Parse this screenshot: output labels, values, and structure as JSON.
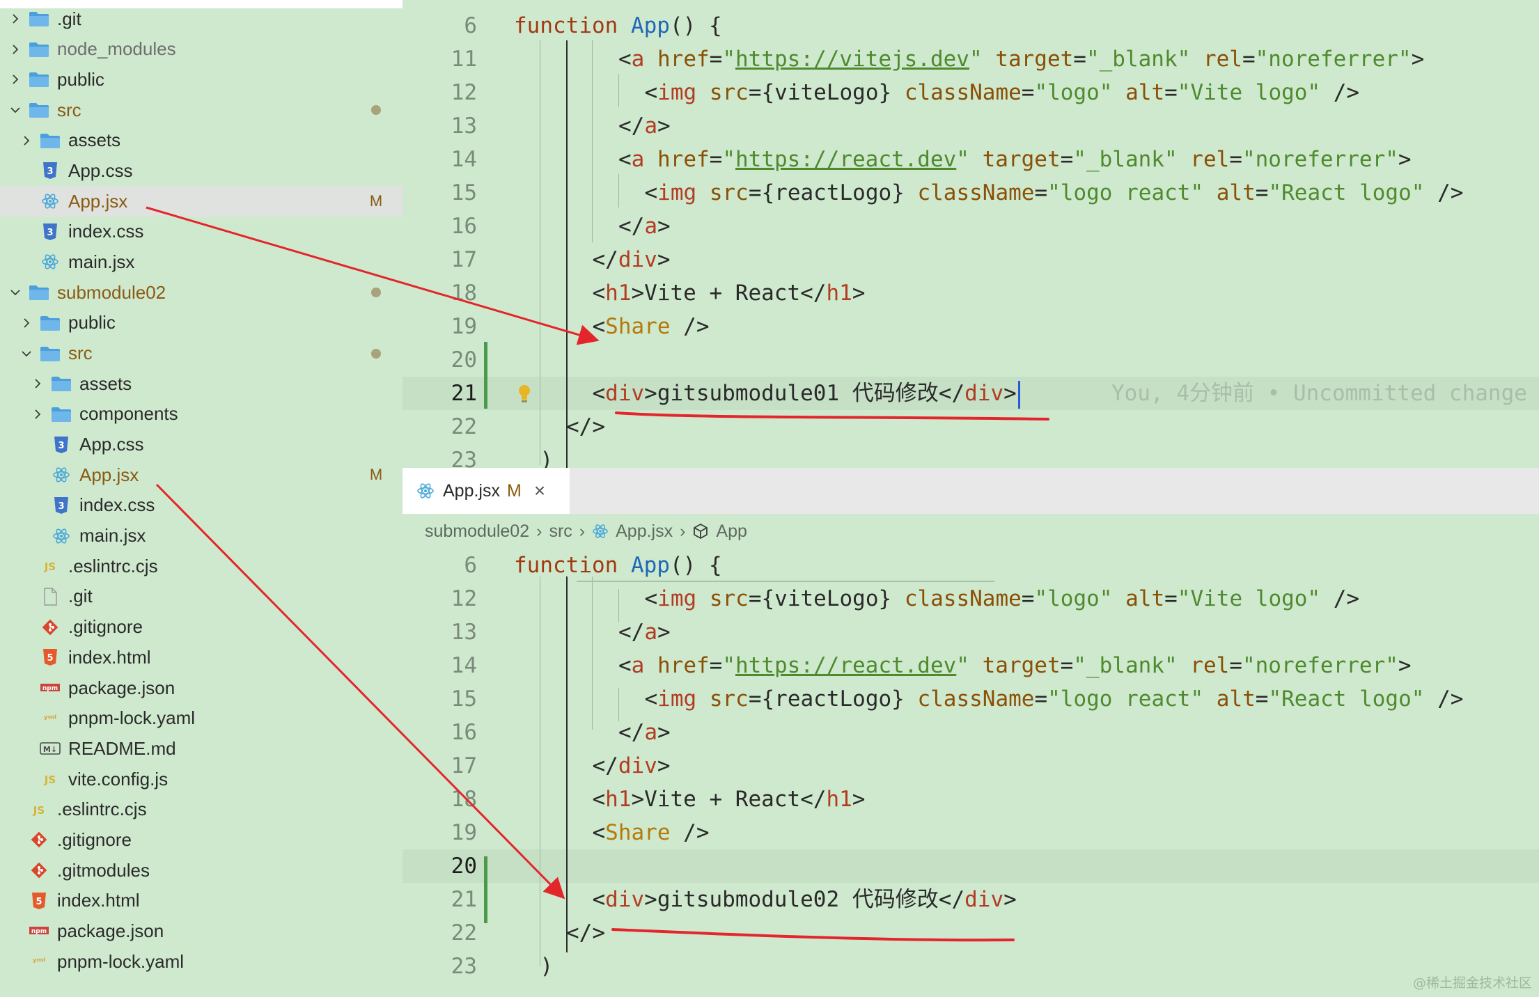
{
  "explorer": {
    "items": [
      {
        "label": ".git",
        "kind": "folder",
        "expanded": false,
        "depth": 0,
        "icon": "folder-icon"
      },
      {
        "label": "node_modules",
        "kind": "folder",
        "expanded": false,
        "depth": 0,
        "icon": "folder-icon",
        "dim": true
      },
      {
        "label": "public",
        "kind": "folder",
        "expanded": false,
        "depth": 0,
        "icon": "folder-icon"
      },
      {
        "label": "src",
        "kind": "folder",
        "expanded": true,
        "depth": 0,
        "icon": "folder-icon",
        "modified": true,
        "status": "dot"
      },
      {
        "label": "assets",
        "kind": "folder",
        "expanded": false,
        "depth": 1,
        "icon": "folder-icon"
      },
      {
        "label": "App.css",
        "kind": "file",
        "depth": 1,
        "icon": "css-file-icon"
      },
      {
        "label": "App.jsx",
        "kind": "file",
        "depth": 1,
        "icon": "react-file-icon",
        "modified": true,
        "status": "M",
        "selected": true
      },
      {
        "label": "index.css",
        "kind": "file",
        "depth": 1,
        "icon": "css-file-icon"
      },
      {
        "label": "main.jsx",
        "kind": "file",
        "depth": 1,
        "icon": "react-file-icon"
      },
      {
        "label": "submodule02",
        "kind": "folder",
        "expanded": true,
        "depth": 0,
        "icon": "folder-icon",
        "modified": true,
        "status": "dot"
      },
      {
        "label": "public",
        "kind": "folder",
        "expanded": false,
        "depth": 1,
        "icon": "folder-icon"
      },
      {
        "label": "src",
        "kind": "folder",
        "expanded": true,
        "depth": 1,
        "icon": "folder-icon",
        "modified": true,
        "status": "dot"
      },
      {
        "label": "assets",
        "kind": "folder",
        "expanded": false,
        "depth": 2,
        "icon": "folder-icon"
      },
      {
        "label": "components",
        "kind": "folder",
        "expanded": false,
        "depth": 2,
        "icon": "folder-icon"
      },
      {
        "label": "App.css",
        "kind": "file",
        "depth": 2,
        "icon": "css-file-icon"
      },
      {
        "label": "App.jsx",
        "kind": "file",
        "depth": 2,
        "icon": "react-file-icon",
        "modified": true,
        "status": "M"
      },
      {
        "label": "index.css",
        "kind": "file",
        "depth": 2,
        "icon": "css-file-icon"
      },
      {
        "label": "main.jsx",
        "kind": "file",
        "depth": 2,
        "icon": "react-file-icon"
      },
      {
        "label": ".eslintrc.cjs",
        "kind": "file",
        "depth": 1,
        "icon": "js-file-icon"
      },
      {
        "label": ".git",
        "kind": "file",
        "depth": 1,
        "icon": "blank-file-icon"
      },
      {
        "label": ".gitignore",
        "kind": "file",
        "depth": 1,
        "icon": "git-file-icon"
      },
      {
        "label": "index.html",
        "kind": "file",
        "depth": 1,
        "icon": "html-file-icon"
      },
      {
        "label": "package.json",
        "kind": "file",
        "depth": 1,
        "icon": "npm-file-icon"
      },
      {
        "label": "pnpm-lock.yaml",
        "kind": "file",
        "depth": 1,
        "icon": "yaml-file-icon"
      },
      {
        "label": "README.md",
        "kind": "file",
        "depth": 1,
        "icon": "markdown-file-icon"
      },
      {
        "label": "vite.config.js",
        "kind": "file",
        "depth": 1,
        "icon": "js-file-icon"
      },
      {
        "label": ".eslintrc.cjs",
        "kind": "file",
        "depth": 0,
        "icon": "js-file-icon"
      },
      {
        "label": ".gitignore",
        "kind": "file",
        "depth": 0,
        "icon": "git-file-icon"
      },
      {
        "label": ".gitmodules",
        "kind": "file",
        "depth": 0,
        "icon": "git-file-icon"
      },
      {
        "label": "index.html",
        "kind": "file",
        "depth": 0,
        "icon": "html-file-icon"
      },
      {
        "label": "package.json",
        "kind": "file",
        "depth": 0,
        "icon": "npm-file-icon"
      },
      {
        "label": "pnpm-lock.yaml",
        "kind": "file",
        "depth": 0,
        "icon": "yaml-file-icon"
      }
    ]
  },
  "editor_top": {
    "lines": [
      {
        "n": "6",
        "tokens": [
          [
            "kw",
            "function "
          ],
          [
            "fn",
            "App"
          ],
          [
            "txt",
            "() {"
          ]
        ]
      },
      {
        "n": "11",
        "tokens": [
          [
            "txt",
            "<"
          ],
          [
            "tag",
            "a"
          ],
          [
            "txt",
            " "
          ],
          [
            "attr",
            "href"
          ],
          [
            "txt",
            "="
          ],
          [
            "str",
            "\""
          ],
          [
            "url",
            "https://vitejs.dev"
          ],
          [
            "str",
            "\""
          ],
          [
            "txt",
            " "
          ],
          [
            "attr",
            "target"
          ],
          [
            "txt",
            "="
          ],
          [
            "str",
            "\"_blank\""
          ],
          [
            "txt",
            " "
          ],
          [
            "attr",
            "rel"
          ],
          [
            "txt",
            "="
          ],
          [
            "str",
            "\"noreferrer\""
          ],
          [
            "txt",
            ">"
          ]
        ],
        "indent": 4
      },
      {
        "n": "12",
        "tokens": [
          [
            "txt",
            "<"
          ],
          [
            "tag",
            "img"
          ],
          [
            "txt",
            " "
          ],
          [
            "attr",
            "src"
          ],
          [
            "txt",
            "={viteLogo} "
          ],
          [
            "attr",
            "className"
          ],
          [
            "txt",
            "="
          ],
          [
            "str",
            "\"logo\""
          ],
          [
            "txt",
            " "
          ],
          [
            "attr",
            "alt"
          ],
          [
            "txt",
            "="
          ],
          [
            "str",
            "\"Vite logo\""
          ],
          [
            "txt",
            " />"
          ]
        ],
        "indent": 5
      },
      {
        "n": "13",
        "tokens": [
          [
            "txt",
            "</"
          ],
          [
            "tag",
            "a"
          ],
          [
            "txt",
            ">"
          ]
        ],
        "indent": 4
      },
      {
        "n": "14",
        "tokens": [
          [
            "txt",
            "<"
          ],
          [
            "tag",
            "a"
          ],
          [
            "txt",
            " "
          ],
          [
            "attr",
            "href"
          ],
          [
            "txt",
            "="
          ],
          [
            "str",
            "\""
          ],
          [
            "url",
            "https://react.dev"
          ],
          [
            "str",
            "\""
          ],
          [
            "txt",
            " "
          ],
          [
            "attr",
            "target"
          ],
          [
            "txt",
            "="
          ],
          [
            "str",
            "\"_blank\""
          ],
          [
            "txt",
            " "
          ],
          [
            "attr",
            "rel"
          ],
          [
            "txt",
            "="
          ],
          [
            "str",
            "\"noreferrer\""
          ],
          [
            "txt",
            ">"
          ]
        ],
        "indent": 4
      },
      {
        "n": "15",
        "tokens": [
          [
            "txt",
            "<"
          ],
          [
            "tag",
            "img"
          ],
          [
            "txt",
            " "
          ],
          [
            "attr",
            "src"
          ],
          [
            "txt",
            "={reactLogo} "
          ],
          [
            "attr",
            "className"
          ],
          [
            "txt",
            "="
          ],
          [
            "str",
            "\"logo react\""
          ],
          [
            "txt",
            " "
          ],
          [
            "attr",
            "alt"
          ],
          [
            "txt",
            "="
          ],
          [
            "str",
            "\"React logo\""
          ],
          [
            "txt",
            " />"
          ]
        ],
        "indent": 5
      },
      {
        "n": "16",
        "tokens": [
          [
            "txt",
            "</"
          ],
          [
            "tag",
            "a"
          ],
          [
            "txt",
            ">"
          ]
        ],
        "indent": 4
      },
      {
        "n": "17",
        "tokens": [
          [
            "txt",
            "</"
          ],
          [
            "tag",
            "div"
          ],
          [
            "txt",
            ">"
          ]
        ],
        "indent": 3
      },
      {
        "n": "18",
        "tokens": [
          [
            "txt",
            "<"
          ],
          [
            "tag",
            "h1"
          ],
          [
            "txt",
            ">Vite + React</"
          ],
          [
            "tag",
            "h1"
          ],
          [
            "txt",
            ">"
          ]
        ],
        "indent": 3
      },
      {
        "n": "19",
        "tokens": [
          [
            "txt",
            "<"
          ],
          [
            "comp",
            "Share"
          ],
          [
            "txt",
            " />"
          ]
        ],
        "indent": 3
      },
      {
        "n": "20",
        "tokens": [],
        "indent": 3
      },
      {
        "n": "21",
        "tokens": [
          [
            "txt",
            "<"
          ],
          [
            "tag",
            "div"
          ],
          [
            "txt",
            ">gitsubmodule01 代码修改</"
          ],
          [
            "tag",
            "div"
          ],
          [
            "txt",
            ">"
          ]
        ],
        "indent": 3,
        "current": true,
        "blame": "You, 4分钟前 • Uncommitted change"
      },
      {
        "n": "22",
        "tokens": [
          [
            "txt",
            "</>"
          ]
        ],
        "indent": 2
      },
      {
        "n": "23",
        "tokens": [
          [
            "txt",
            ")"
          ]
        ],
        "indent": 1
      }
    ]
  },
  "tab": {
    "label": "App.jsx",
    "modified": "M",
    "close": "×"
  },
  "breadcrumb": [
    "submodule02",
    "src",
    "App.jsx",
    "App"
  ],
  "editor_bottom": {
    "lines": [
      {
        "n": "6",
        "tokens": [
          [
            "kw",
            "function "
          ],
          [
            "fn",
            "App"
          ],
          [
            "txt",
            "() {"
          ]
        ]
      },
      {
        "n": "12",
        "tokens": [
          [
            "txt",
            "<"
          ],
          [
            "tag",
            "img"
          ],
          [
            "txt",
            " "
          ],
          [
            "attr",
            "src"
          ],
          [
            "txt",
            "={viteLogo} "
          ],
          [
            "attr",
            "className"
          ],
          [
            "txt",
            "="
          ],
          [
            "str",
            "\"logo\""
          ],
          [
            "txt",
            " "
          ],
          [
            "attr",
            "alt"
          ],
          [
            "txt",
            "="
          ],
          [
            "str",
            "\"Vite logo\""
          ],
          [
            "txt",
            " />"
          ]
        ],
        "indent": 5
      },
      {
        "n": "13",
        "tokens": [
          [
            "txt",
            "</"
          ],
          [
            "tag",
            "a"
          ],
          [
            "txt",
            ">"
          ]
        ],
        "indent": 4
      },
      {
        "n": "14",
        "tokens": [
          [
            "txt",
            "<"
          ],
          [
            "tag",
            "a"
          ],
          [
            "txt",
            " "
          ],
          [
            "attr",
            "href"
          ],
          [
            "txt",
            "="
          ],
          [
            "str",
            "\""
          ],
          [
            "url",
            "https://react.dev"
          ],
          [
            "str",
            "\""
          ],
          [
            "txt",
            " "
          ],
          [
            "attr",
            "target"
          ],
          [
            "txt",
            "="
          ],
          [
            "str",
            "\"_blank\""
          ],
          [
            "txt",
            " "
          ],
          [
            "attr",
            "rel"
          ],
          [
            "txt",
            "="
          ],
          [
            "str",
            "\"noreferrer\""
          ],
          [
            "txt",
            ">"
          ]
        ],
        "indent": 4
      },
      {
        "n": "15",
        "tokens": [
          [
            "txt",
            "<"
          ],
          [
            "tag",
            "img"
          ],
          [
            "txt",
            " "
          ],
          [
            "attr",
            "src"
          ],
          [
            "txt",
            "={reactLogo} "
          ],
          [
            "attr",
            "className"
          ],
          [
            "txt",
            "="
          ],
          [
            "str",
            "\"logo react\""
          ],
          [
            "txt",
            " "
          ],
          [
            "attr",
            "alt"
          ],
          [
            "txt",
            "="
          ],
          [
            "str",
            "\"React logo\""
          ],
          [
            "txt",
            " />"
          ]
        ],
        "indent": 5
      },
      {
        "n": "16",
        "tokens": [
          [
            "txt",
            "</"
          ],
          [
            "tag",
            "a"
          ],
          [
            "txt",
            ">"
          ]
        ],
        "indent": 4
      },
      {
        "n": "17",
        "tokens": [
          [
            "txt",
            "</"
          ],
          [
            "tag",
            "div"
          ],
          [
            "txt",
            ">"
          ]
        ],
        "indent": 3
      },
      {
        "n": "18",
        "tokens": [
          [
            "txt",
            "<"
          ],
          [
            "tag",
            "h1"
          ],
          [
            "txt",
            ">Vite + React</"
          ],
          [
            "tag",
            "h1"
          ],
          [
            "txt",
            ">"
          ]
        ],
        "indent": 3
      },
      {
        "n": "19",
        "tokens": [
          [
            "txt",
            "<"
          ],
          [
            "comp",
            "Share"
          ],
          [
            "txt",
            " />"
          ]
        ],
        "indent": 3
      },
      {
        "n": "20",
        "tokens": [],
        "indent": 3,
        "current": true
      },
      {
        "n": "21",
        "tokens": [
          [
            "txt",
            "<"
          ],
          [
            "tag",
            "div"
          ],
          [
            "txt",
            ">gitsubmodule02 代码修改</"
          ],
          [
            "tag",
            "div"
          ],
          [
            "txt",
            ">"
          ]
        ],
        "indent": 3
      },
      {
        "n": "22",
        "tokens": [
          [
            "txt",
            "</>"
          ]
        ],
        "indent": 2
      },
      {
        "n": "23",
        "tokens": [
          [
            "txt",
            ")"
          ]
        ],
        "indent": 1
      }
    ]
  },
  "watermark": "@稀土掘金技术社区",
  "colors": {
    "background": "#cfe9cf",
    "annotation_red": "#e3262b",
    "modified": "#8a5a12",
    "git_added": "#4b9a4b"
  }
}
